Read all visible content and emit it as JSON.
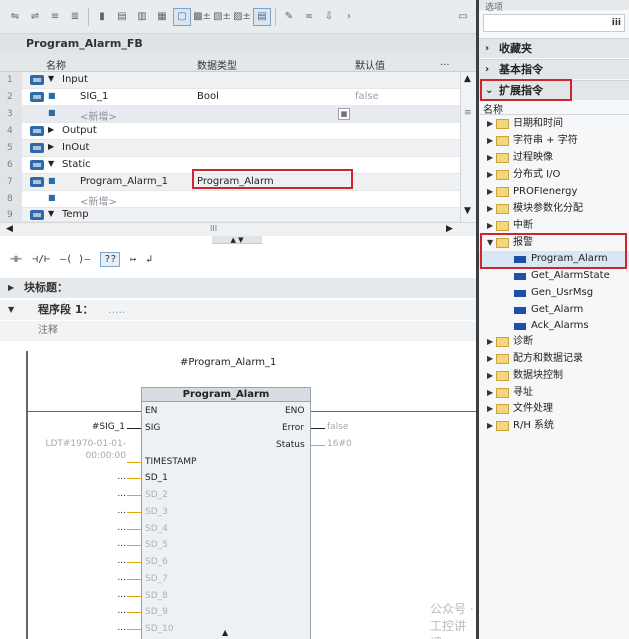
{
  "left": {
    "block_title": "Program_Alarm_FB",
    "columns": {
      "name": "名称",
      "type": "数据类型",
      "default": "默认值",
      "more": "..."
    },
    "rows": [
      {
        "num": "1",
        "name": "Input",
        "type": "",
        "default": "",
        "kind": "section"
      },
      {
        "num": "2",
        "name": "SIG_1",
        "type": "Bool",
        "default": "false",
        "kind": "var"
      },
      {
        "num": "3",
        "name": "<新增>",
        "type": "",
        "default": "",
        "kind": "new"
      },
      {
        "num": "4",
        "name": "Output",
        "type": "",
        "default": "",
        "kind": "section"
      },
      {
        "num": "5",
        "name": "InOut",
        "type": "",
        "default": "",
        "kind": "section"
      },
      {
        "num": "6",
        "name": "Static",
        "type": "",
        "default": "",
        "kind": "section"
      },
      {
        "num": "7",
        "name": "Program_Alarm_1",
        "type": "Program_Alarm",
        "default": "",
        "kind": "var"
      },
      {
        "num": "8",
        "name": "<新增>",
        "type": "",
        "default": "",
        "kind": "new"
      },
      {
        "num": "9",
        "name": "Temp",
        "type": "",
        "default": "",
        "kind": "section"
      }
    ],
    "hscroll_label": "III",
    "ladder_buttons": [
      "⊣⊢",
      "⊣/⊢",
      "–( )–",
      "??",
      "↦",
      "↲"
    ],
    "block_title_label": "块标题：",
    "segment_label": "程序段 1：",
    "segment_dots": ".....",
    "comment": "注释",
    "instance": "#Program_Alarm_1",
    "fb_name": "Program_Alarm",
    "pins_left": [
      "EN",
      "SIG",
      "TIMESTAMP",
      "SD_1",
      "SD_2",
      "SD_3",
      "SD_4",
      "SD_5",
      "SD_6",
      "SD_7",
      "SD_8",
      "SD_9",
      "SD_10"
    ],
    "pins_right": [
      "ENO",
      "Error",
      "Status"
    ],
    "ext_left": {
      "sig": "#SIG_1",
      "timestamp": "LDT#1970-01-01-00:00:00",
      "sd": "..."
    },
    "ext_right": {
      "error": "false",
      "status": "16#0"
    },
    "watermark": "公众号 · 工控讲课"
  },
  "right": {
    "top_label": "选项",
    "search_mini": "iii",
    "sections": [
      {
        "label": "收藏夹",
        "arrow": "›"
      },
      {
        "label": "基本指令",
        "arrow": "›"
      },
      {
        "label": "扩展指令",
        "arrow": "⌄"
      }
    ],
    "col_header": "名称",
    "items": [
      {
        "label": "日期和时间",
        "expanded": false
      },
      {
        "label": "字符串 + 字符",
        "expanded": false
      },
      {
        "label": "过程映像",
        "expanded": false
      },
      {
        "label": "分布式 I/O",
        "expanded": false
      },
      {
        "label": "PROFIenergy",
        "expanded": false
      },
      {
        "label": "模块参数化分配",
        "expanded": false
      },
      {
        "label": "中断",
        "expanded": false
      },
      {
        "label": "报警",
        "expanded": true
      }
    ],
    "alarm_children": [
      "Program_Alarm",
      "Get_AlarmState",
      "Gen_UsrMsg",
      "Get_Alarm",
      "Ack_Alarms"
    ],
    "items_after": [
      "诊断",
      "配方和数据记录",
      "数据块控制",
      "寻址",
      "文件处理",
      "R/H 系统"
    ]
  }
}
